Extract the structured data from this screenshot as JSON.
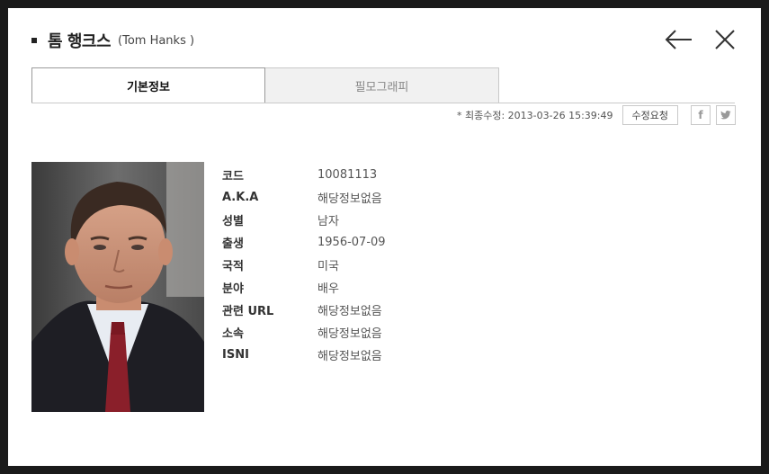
{
  "header": {
    "name_ko": "톰 행크스",
    "name_en": "(Tom Hanks )"
  },
  "tabs": [
    {
      "label": "기본정보",
      "active": true
    },
    {
      "label": "필모그래피",
      "active": false
    }
  ],
  "meta": {
    "updated": "* 최종수정: 2013-03-26 15:39:49",
    "edit_label": "수정요청",
    "facebook_label": "f"
  },
  "info": [
    {
      "label": "코드",
      "value": "10081113"
    },
    {
      "label": "A.K.A",
      "value": "해당정보없음"
    },
    {
      "label": "성별",
      "value": "남자"
    },
    {
      "label": "출생",
      "value": "1956-07-09"
    },
    {
      "label": "국적",
      "value": "미국"
    },
    {
      "label": "분야",
      "value": "배우"
    },
    {
      "label": "관련 URL",
      "value": "해당정보없음"
    },
    {
      "label": "소속",
      "value": "해당정보없음"
    },
    {
      "label": "ISNI",
      "value": "해당정보없음"
    }
  ],
  "icons": {
    "back": "arrow-left-icon",
    "close": "close-icon",
    "facebook": "facebook-icon",
    "twitter": "twitter-icon"
  }
}
